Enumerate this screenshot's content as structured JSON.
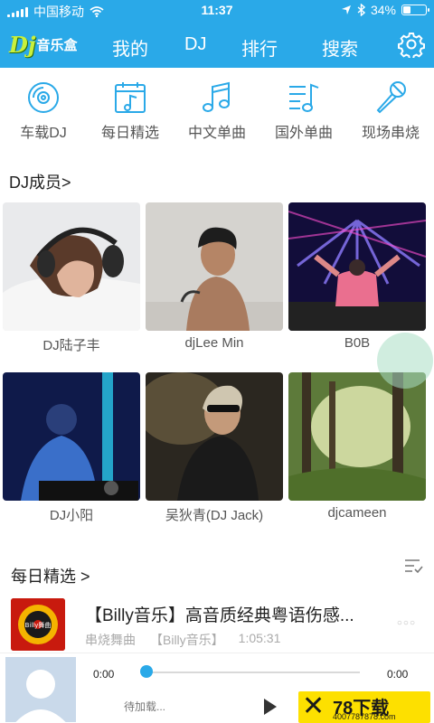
{
  "status_bar": {
    "carrier": "中国移动",
    "time": "11:37",
    "battery": "34%",
    "battery_level": 0.34
  },
  "nav": {
    "logo_dj": "Dj",
    "logo_text": "音乐盒",
    "tabs": [
      {
        "label": "我的"
      },
      {
        "label": "DJ"
      },
      {
        "label": "排行"
      },
      {
        "label": "搜索"
      }
    ]
  },
  "categories": [
    {
      "label": "车载DJ",
      "icon": "disc-icon"
    },
    {
      "label": "每日精选",
      "icon": "calendar-music-icon"
    },
    {
      "label": "中文单曲",
      "icon": "music-note-icon"
    },
    {
      "label": "国外单曲",
      "icon": "playlist-icon"
    },
    {
      "label": "现场串烧",
      "icon": "microphone-icon"
    }
  ],
  "members_section": {
    "title": "DJ成员>"
  },
  "members": [
    {
      "name": "DJ陆子丰"
    },
    {
      "name": "djLee Min"
    },
    {
      "name": "B0B"
    },
    {
      "name": "DJ小阳"
    },
    {
      "name": "吴狄青(DJ Jack)"
    },
    {
      "name": "djcameen"
    }
  ],
  "daily_section": {
    "title": "每日精选 >"
  },
  "daily": [
    {
      "title": "【Billy音乐】高音质经典粤语伤感...",
      "category": "串烧舞曲",
      "author": "【Billy音乐】",
      "duration": "1:05:31",
      "cover_text": "Billy舞曲"
    }
  ],
  "player": {
    "current_time": "0:00",
    "total_time": "0:00",
    "status": "待加载...",
    "progress": 0
  },
  "watermark": {
    "brand": "78下载",
    "url": "4007787878.com"
  },
  "colors": {
    "accent": "#2aa9e8",
    "watermark": "#fde000"
  }
}
